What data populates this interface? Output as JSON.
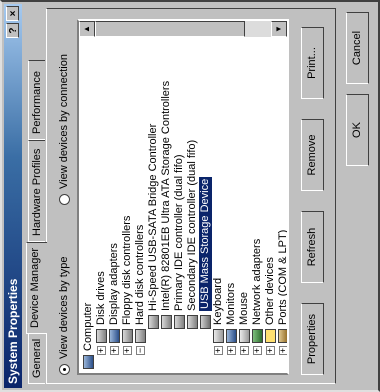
{
  "window": {
    "title": "System Properties",
    "help_label": "?",
    "close_label": "×"
  },
  "tabs": [
    {
      "label": "General"
    },
    {
      "label": "Device Manager"
    },
    {
      "label": "Hardware Profiles"
    },
    {
      "label": "Performance"
    }
  ],
  "view_options": {
    "by_type": "View devices by type",
    "by_connection": "View devices by connection",
    "selected": "by_type"
  },
  "devices": [
    {
      "label": "Computer",
      "icon": "computer-icon",
      "level": 0,
      "expander": ""
    },
    {
      "label": "Disk drives",
      "icon": "disk-drive-icon",
      "level": 1,
      "expander": "+"
    },
    {
      "label": "Display adapters",
      "icon": "display-adapter-icon",
      "level": 1,
      "expander": "+"
    },
    {
      "label": "Floppy disk controllers",
      "icon": "floppy-controller-icon",
      "level": 1,
      "expander": "+"
    },
    {
      "label": "Hard disk controllers",
      "icon": "hard-disk-controller-icon",
      "level": 1,
      "expander": "−"
    },
    {
      "label": "Hi-Speed USB-SATA Bridge Controller",
      "icon": "controller-icon",
      "level": 2,
      "expander": ""
    },
    {
      "label": "Intel(R) 82801EB Ultra ATA Storage Controllers",
      "icon": "controller-icon",
      "level": 2,
      "expander": ""
    },
    {
      "label": "Primary IDE controller (dual fifo)",
      "icon": "controller-icon",
      "level": 2,
      "expander": ""
    },
    {
      "label": "Secondary IDE controller (dual fifo)",
      "icon": "controller-icon",
      "level": 2,
      "expander": ""
    },
    {
      "label": "USB Mass Storage Device",
      "icon": "usb-device-icon",
      "level": 2,
      "expander": "",
      "selected": true
    },
    {
      "label": "Keyboard",
      "icon": "keyboard-icon",
      "level": 1,
      "expander": "+"
    },
    {
      "label": "Monitors",
      "icon": "monitor-icon",
      "level": 1,
      "expander": "+"
    },
    {
      "label": "Mouse",
      "icon": "mouse-icon",
      "level": 1,
      "expander": "+"
    },
    {
      "label": "Network adapters",
      "icon": "network-adapter-icon",
      "level": 1,
      "expander": "+"
    },
    {
      "label": "Other devices",
      "icon": "other-devices-icon",
      "level": 1,
      "expander": "+"
    },
    {
      "label": "Ports (COM & LPT)",
      "icon": "ports-icon",
      "level": 1,
      "expander": "+"
    }
  ],
  "buttons": {
    "properties": "Properties",
    "refresh": "Refresh",
    "remove": "Remove",
    "print": "Print...",
    "ok": "OK",
    "cancel": "Cancel"
  }
}
